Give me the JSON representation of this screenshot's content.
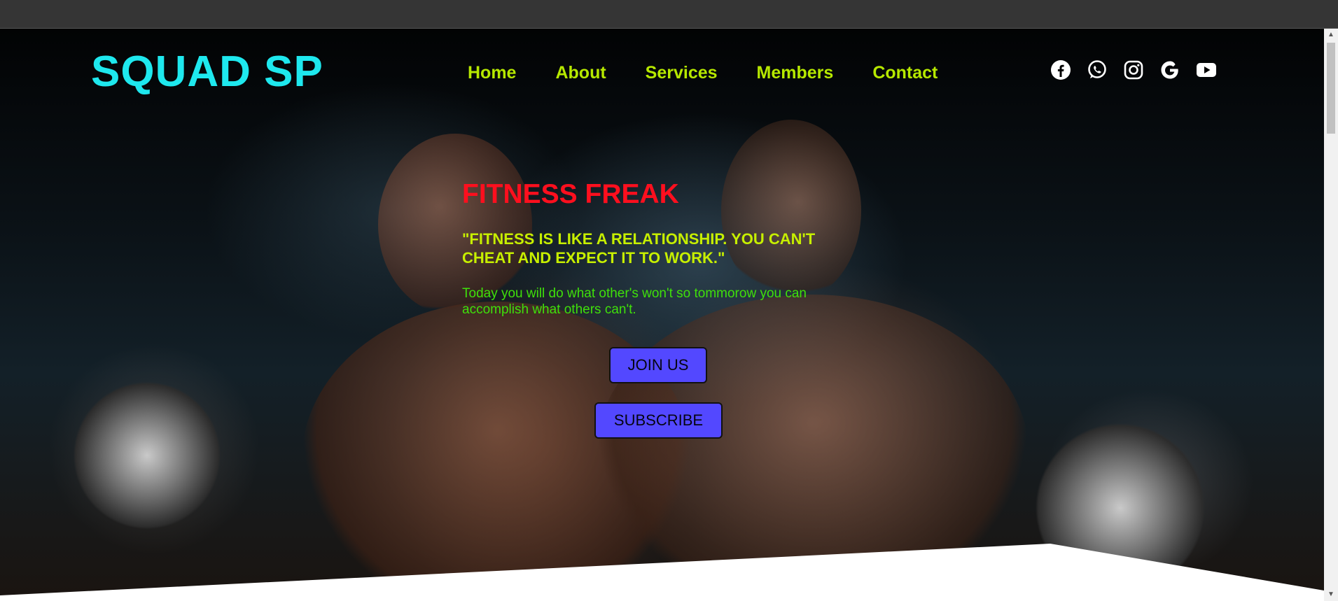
{
  "brand": {
    "logo_text": "SQUAD SP",
    "logo_color": "#1ee8ee"
  },
  "nav": {
    "items": [
      {
        "label": "Home"
      },
      {
        "label": "About"
      },
      {
        "label": "Services"
      },
      {
        "label": "Members"
      },
      {
        "label": "Contact"
      }
    ],
    "color": "#b6e800"
  },
  "socials": [
    "facebook-icon",
    "whatsapp-icon",
    "instagram-icon",
    "google-icon",
    "youtube-icon"
  ],
  "hero": {
    "title": "FITNESS FREAK",
    "quote": "\"FITNESS IS LIKE A RELATIONSHIP. YOU CAN'T CHEAT AND EXPECT IT TO WORK.\"",
    "subtitle": "Today you will do what other's won't so tommorow you can accomplish what others can't.",
    "join_label": "JOIN US",
    "subscribe_label": "SUBSCRIBE",
    "title_color": "#ff0f1e",
    "quote_color": "#c7ef00",
    "subtitle_color": "#3fe00a",
    "button_color": "#5348ff"
  }
}
